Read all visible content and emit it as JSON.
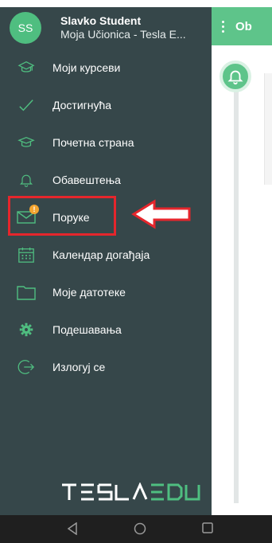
{
  "header": {
    "title_partial": "Ob"
  },
  "user": {
    "initials": "SS",
    "name": "Slavko Student",
    "school": "Moja Učionica - Tesla E..."
  },
  "menu": [
    {
      "label": "Моји курсеви",
      "icon": "mortarboard-icon"
    },
    {
      "label": "Достигнућа",
      "icon": "checkmark-icon"
    },
    {
      "label": "Почетна страна",
      "icon": "graduation-cap-icon"
    },
    {
      "label": "Обавештења",
      "icon": "bell-icon"
    },
    {
      "label": "Поруке",
      "icon": "envelope-icon",
      "badge": "!"
    },
    {
      "label": "Календар догађаја",
      "icon": "calendar-icon"
    },
    {
      "label": "Моје датотеке",
      "icon": "folder-icon"
    },
    {
      "label": "Подешавања",
      "icon": "gear-icon"
    },
    {
      "label": "Излогуј се",
      "icon": "logout-icon"
    }
  ],
  "brand": {
    "logo_text": "TESLAEDU"
  },
  "colors": {
    "drawer_bg": "#36474a",
    "accent": "#4fbe80",
    "highlight": "#e5262c",
    "badge": "#f3a530"
  },
  "navbar": {
    "buttons": [
      "back-icon",
      "home-icon",
      "recents-icon"
    ]
  }
}
